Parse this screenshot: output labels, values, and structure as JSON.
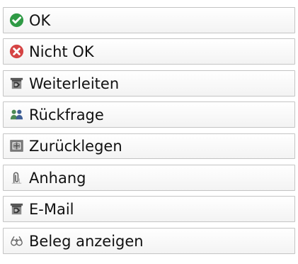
{
  "colors": {
    "ok_green": "#2f9a45",
    "error_red": "#d54444",
    "icon_gray": "#6b6b6b",
    "user_green": "#4c8a55",
    "user_blue": "#3f5f95",
    "border": "#c4c4c4"
  },
  "actions": [
    {
      "label": "OK",
      "icon": "check-circle-icon"
    },
    {
      "label": "Nicht OK",
      "icon": "x-circle-icon"
    },
    {
      "label": "Weiterleiten",
      "icon": "forward-tray-icon"
    },
    {
      "label": "Rückfrage",
      "icon": "users-icon"
    },
    {
      "label": "Zurücklegen",
      "icon": "shelve-box-icon"
    },
    {
      "label": "Anhang",
      "icon": "paperclip-icon"
    },
    {
      "label": "E-Mail",
      "icon": "mail-forward-icon"
    },
    {
      "label": "Beleg anzeigen",
      "icon": "glasses-icon"
    }
  ]
}
